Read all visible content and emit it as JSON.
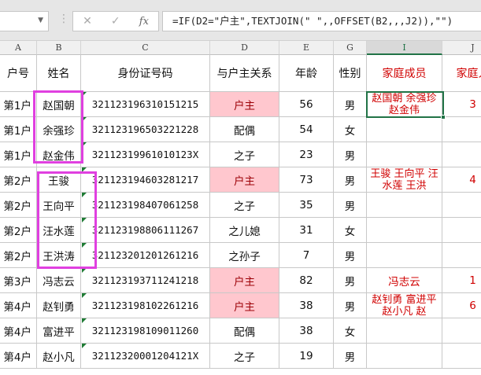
{
  "formula_bar": {
    "formula": "=IF(D2=\"户主\",TEXTJOIN(\" \",,OFFSET(B2,,,J2)),\"\")",
    "cancel_icon": "✕",
    "enter_icon": "✓",
    "fx_label": "fx"
  },
  "columns": [
    "A",
    "B",
    "C",
    "D",
    "E",
    "G",
    "I",
    "J"
  ],
  "headers": [
    "户号",
    "姓名",
    "身份证号码",
    "与户主关系",
    "年龄",
    "性别",
    "家庭成员",
    "家庭人"
  ],
  "rows": [
    {
      "a": "第1户",
      "b": "赵国朝",
      "c": "321123196310151215",
      "d": "户主",
      "e": "56",
      "g": "男",
      "i": "赵国朝 余强珍 赵金伟",
      "j": "3"
    },
    {
      "a": "第1户",
      "b": "余强珍",
      "c": "321123196503221228",
      "d": "配偶",
      "e": "54",
      "g": "女",
      "i": "",
      "j": ""
    },
    {
      "a": "第1户",
      "b": "赵金伟",
      "c": "32112319961010123X",
      "d": "之子",
      "e": "23",
      "g": "男",
      "i": "",
      "j": ""
    },
    {
      "a": "第2户",
      "b": "王骏",
      "c": "321123194603281217",
      "d": "户主",
      "e": "73",
      "g": "男",
      "i": "王骏 王向平 汪水莲 王洪",
      "j": "4"
    },
    {
      "a": "第2户",
      "b": "王向平",
      "c": "321123198407061258",
      "d": "之子",
      "e": "35",
      "g": "男",
      "i": "",
      "j": ""
    },
    {
      "a": "第2户",
      "b": "汪水莲",
      "c": "321123198806111267",
      "d": "之儿媳",
      "e": "31",
      "g": "女",
      "i": "",
      "j": ""
    },
    {
      "a": "第2户",
      "b": "王洪涛",
      "c": "321123201201261216",
      "d": "之孙子",
      "e": "7",
      "g": "男",
      "i": "",
      "j": ""
    },
    {
      "a": "第3户",
      "b": "冯志云",
      "c": "321123193711241218",
      "d": "户主",
      "e": "82",
      "g": "男",
      "i": "冯志云",
      "j": "1"
    },
    {
      "a": "第4户",
      "b": "赵钊勇",
      "c": "321123198102261216",
      "d": "户主",
      "e": "38",
      "g": "男",
      "i": "赵钊勇 富进平 赵小凡 赵",
      "j": "6"
    },
    {
      "a": "第4户",
      "b": "富进平",
      "c": "321123198109011260",
      "d": "配偶",
      "e": "38",
      "g": "女",
      "i": "",
      "j": ""
    },
    {
      "a": "第4户",
      "b": "赵小凡",
      "c": "32112320001204121X",
      "d": "之子",
      "e": "19",
      "g": "男",
      "i": "",
      "j": ""
    }
  ]
}
